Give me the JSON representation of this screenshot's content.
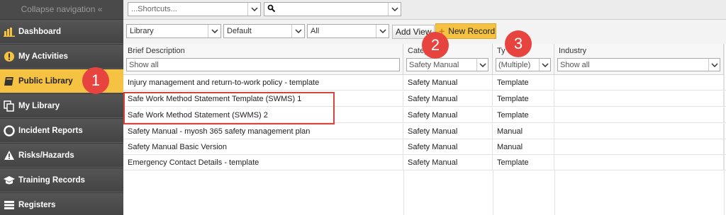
{
  "sidebar": {
    "collapse_label": "Collapse navigation «",
    "items": [
      {
        "label": "Dashboard",
        "icon": "bar-chart-icon"
      },
      {
        "label": "My Activities",
        "icon": "alert-icon"
      },
      {
        "label": "Public Library",
        "icon": "book-icon"
      },
      {
        "label": "My Library",
        "icon": "copy-icon"
      },
      {
        "label": "Incident Reports",
        "icon": "lifebuoy-icon"
      },
      {
        "label": "Risks/Hazards",
        "icon": "warning-icon"
      },
      {
        "label": "Training Records",
        "icon": "graduation-cap-icon"
      },
      {
        "label": "Registers",
        "icon": "list-icon"
      }
    ]
  },
  "topbar": {
    "shortcuts_placeholder": "...Shortcuts...",
    "search_value": ""
  },
  "toolbar": {
    "library_select": "Library",
    "view_select": "Default",
    "filter_select": "All",
    "add_view_label": "Add View",
    "new_record_label": "New Record"
  },
  "grid": {
    "columns": [
      {
        "label": "Brief Description",
        "filter": "Show all"
      },
      {
        "label": "Categ",
        "filter": "Safety Manual"
      },
      {
        "label": "Ty",
        "filter": "(Multiple)"
      },
      {
        "label": "Industry",
        "filter": "Show all"
      }
    ],
    "rows": [
      [
        "Injury management and return-to-work policy - template",
        "Safety Manual",
        "Template",
        ""
      ],
      [
        "Safe Work Method Statement Template (SWMS) 1",
        "Safety Manual",
        "Template",
        ""
      ],
      [
        "Safe Work Method Statement (SWMS) 2",
        "Safety Manual",
        "Template",
        ""
      ],
      [
        "Safety Manual - myosh 365 safety management plan",
        "Safety Manual",
        "Manual",
        ""
      ],
      [
        "Safety Manual Basic Version",
        "Safety Manual",
        "Manual",
        ""
      ],
      [
        "Emergency Contact Details - template",
        "Safety Manual",
        "Template",
        ""
      ]
    ]
  },
  "annotations": {
    "badge1": "1",
    "badge2": "2",
    "badge3": "3"
  },
  "colors": {
    "accent": "#f6c242",
    "annotation": "#e8443f",
    "sidebar_bg": "#4d4d4d"
  }
}
